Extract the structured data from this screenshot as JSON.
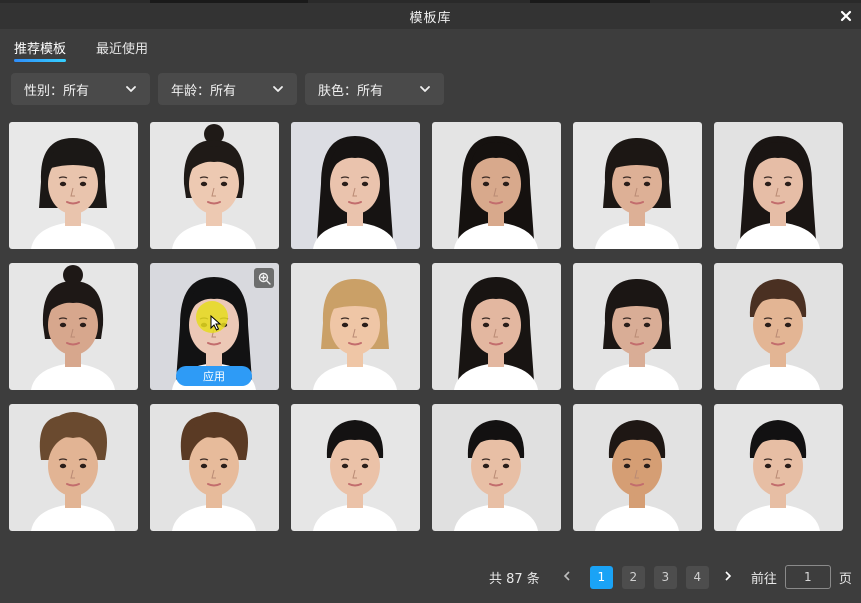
{
  "window": {
    "title": "模板库"
  },
  "tabs": [
    {
      "label": "推荐模板",
      "active": true
    },
    {
      "label": "最近使用",
      "active": false
    }
  ],
  "filters": [
    {
      "label": "性别：所有"
    },
    {
      "label": "年龄：所有"
    },
    {
      "label": "肤色：所有"
    }
  ],
  "templates": [
    {
      "hair": "#1b1816",
      "skin": "#e9c4ad",
      "bg": "#e8e8e8",
      "style": "bob"
    },
    {
      "hair": "#1f1a17",
      "skin": "#edc9b2",
      "bg": "#e6e6e6",
      "style": "bun"
    },
    {
      "hair": "#161312",
      "skin": "#eac3ad",
      "bg": "#dcdde3",
      "style": "long"
    },
    {
      "hair": "#15110f",
      "skin": "#d8a98c",
      "bg": "#e4e4e4",
      "style": "long"
    },
    {
      "hair": "#1c1714",
      "skin": "#ddb096",
      "bg": "#e7e7e7",
      "style": "bob"
    },
    {
      "hair": "#1a1513",
      "skin": "#e6bda6",
      "bg": "#e2e2e2",
      "style": "long"
    },
    {
      "hair": "#1e1816",
      "skin": "#d7a78d",
      "bg": "#e6e6e6",
      "style": "bun"
    },
    {
      "hair": "#121213",
      "skin": "#ecc8b6",
      "bg": "#d8d9de",
      "style": "long",
      "hover": true
    },
    {
      "hair": "#caa067",
      "skin": "#efc6a6",
      "bg": "#e4e4e4",
      "style": "bob"
    },
    {
      "hair": "#181412",
      "skin": "#e3b7a0",
      "bg": "#e3e3e3",
      "style": "long"
    },
    {
      "hair": "#1b1614",
      "skin": "#d9ad96",
      "bg": "#e4e4e4",
      "style": "bob"
    },
    {
      "hair": "#4a3022",
      "skin": "#e3b594",
      "bg": "#e1e1e1",
      "style": "short"
    },
    {
      "hair": "#6a4a2f",
      "skin": "#e2b494",
      "bg": "#e4e4e4",
      "style": "curly"
    },
    {
      "hair": "#5a3a24",
      "skin": "#e7bb9b",
      "bg": "#e3e3e3",
      "style": "curly"
    },
    {
      "hair": "#141212",
      "skin": "#ebc2a8",
      "bg": "#e6e6e6",
      "style": "short"
    },
    {
      "hair": "#131111",
      "skin": "#e8bfa5",
      "bg": "#e0e0e0",
      "style": "short"
    },
    {
      "hair": "#1e1714",
      "skin": "#d59e74",
      "bg": "#e2e2e2",
      "style": "short"
    },
    {
      "hair": "#121112",
      "skin": "#e7bea4",
      "bg": "#e4e4e4",
      "style": "short"
    }
  ],
  "card_actions": {
    "apply_label": "应用",
    "zoom_icon": "zoom-in-icon"
  },
  "pagination": {
    "total_label": "共 87 条",
    "pages": [
      "1",
      "2",
      "3",
      "4"
    ],
    "current_page": "1",
    "goto_label": "前往",
    "goto_value": "1",
    "page_unit": "页"
  },
  "colors": {
    "accent": "#1aa3f6",
    "apply_button": "#2e9bf6",
    "background": "#3d3d3d"
  }
}
